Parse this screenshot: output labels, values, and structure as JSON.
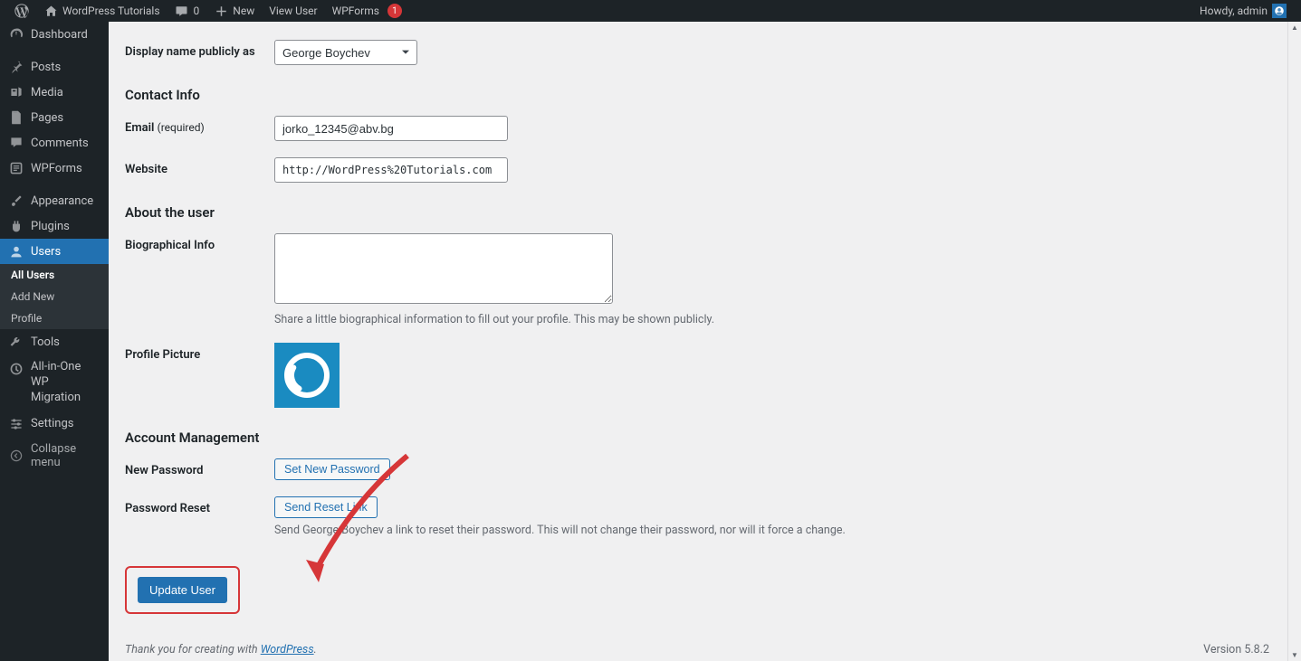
{
  "adminbar": {
    "site_name": "WordPress Tutorials",
    "comments_count": "0",
    "new_label": "New",
    "view_user_label": "View User",
    "wpforms_label": "WPForms",
    "wpforms_badge": "1",
    "howdy": "Howdy, admin"
  },
  "sidebar": {
    "items": [
      {
        "label": "Dashboard",
        "icon": "dashboard"
      },
      {
        "label": "Posts",
        "icon": "pin"
      },
      {
        "label": "Media",
        "icon": "media"
      },
      {
        "label": "Pages",
        "icon": "pages"
      },
      {
        "label": "Comments",
        "icon": "comment"
      },
      {
        "label": "WPForms",
        "icon": "form"
      },
      {
        "label": "Appearance",
        "icon": "brush"
      },
      {
        "label": "Plugins",
        "icon": "plug"
      },
      {
        "label": "Users",
        "icon": "user",
        "current": true
      },
      {
        "label": "Tools",
        "icon": "wrench"
      },
      {
        "label": "All-in-One WP Migration",
        "icon": "migrate"
      },
      {
        "label": "Settings",
        "icon": "slider"
      },
      {
        "label": "Collapse menu",
        "icon": "collapse"
      }
    ],
    "submenu_users": [
      {
        "label": "All Users",
        "current": true
      },
      {
        "label": "Add New"
      },
      {
        "label": "Profile"
      }
    ]
  },
  "form": {
    "display_name_label": "Display name publicly as",
    "display_name_value": "George Boychev",
    "contact_heading": "Contact Info",
    "email_label": "Email",
    "email_req": "(required)",
    "email_value": "jorko_12345@abv.bg",
    "website_label": "Website",
    "website_value": "http://WordPress%20Tutorials.com",
    "about_heading": "About the user",
    "bio_label": "Biographical Info",
    "bio_value": "",
    "bio_desc": "Share a little biographical information to fill out your profile. This may be shown publicly.",
    "picture_label": "Profile Picture",
    "account_heading": "Account Management",
    "newpass_label": "New Password",
    "newpass_button": "Set New Password",
    "reset_label": "Password Reset",
    "reset_button": "Send Reset Link",
    "reset_desc": "Send George Boychev a link to reset their password. This will not change their password, nor will it force a change.",
    "submit": "Update User"
  },
  "footer": {
    "thanks_prefix": "Thank you for creating with ",
    "thanks_link": "WordPress",
    "thanks_suffix": ".",
    "version": "Version 5.8.2"
  }
}
